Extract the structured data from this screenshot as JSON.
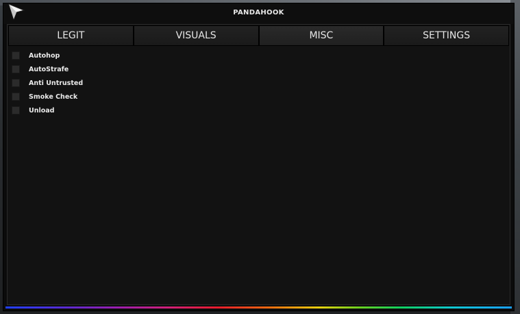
{
  "window": {
    "title": "PANDAHOOK"
  },
  "tabs": [
    {
      "label": "LEGIT",
      "active": false
    },
    {
      "label": "VISUALS",
      "active": false
    },
    {
      "label": "MISC",
      "active": true
    },
    {
      "label": "SETTINGS",
      "active": false
    }
  ],
  "options": [
    {
      "label": "Autohop",
      "checked": false
    },
    {
      "label": "AutoStrafe",
      "checked": false
    },
    {
      "label": "Anti Untrusted",
      "checked": false
    },
    {
      "label": "Smoke Check",
      "checked": false
    },
    {
      "label": "Unload",
      "checked": false
    }
  ],
  "colors": {
    "window_bg": "#0b0b0b",
    "panel_bg": "#121212",
    "checkbox_bg": "#2b2b2b",
    "text": "#eaeaea"
  },
  "icons": {
    "cursor": "cursor-arrow-icon"
  }
}
